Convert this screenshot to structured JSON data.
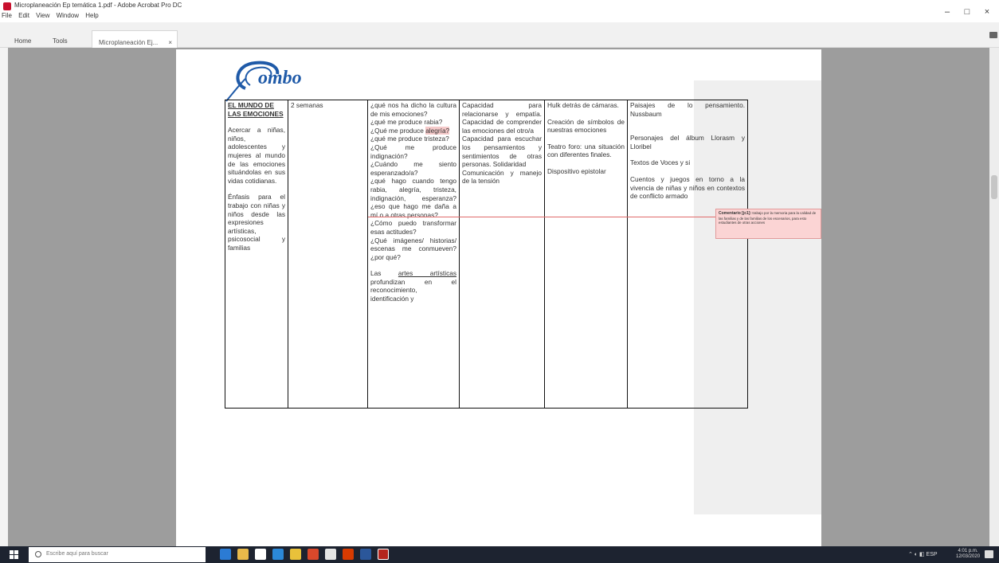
{
  "window": {
    "title": "Microplaneación Ep temática 1.pdf - Adobe Acrobat Pro DC",
    "menu": [
      "File",
      "Edit",
      "View",
      "Window",
      "Help"
    ],
    "controls": [
      "–",
      "□",
      "×"
    ]
  },
  "tabs": {
    "home": "Home",
    "tools": "Tools",
    "document": "Microplaneación Ej...",
    "close": "×"
  },
  "table": {
    "col1": {
      "title": "EL MUNDO DE LAS EMOCIONES",
      "p1": "Acercar a niñas, niños, adolescentes y mujeres al mundo de las emociones situándolas en sus vidas cotidianas.",
      "p2": "Énfasis para el trabajo con niñas y niños desde las expresiones artísticas, psicosocial y familias"
    },
    "col2": {
      "text": "2 semanas"
    },
    "col3": {
      "p1": "¿qué nos ha dicho la cultura de mis emociones?",
      "p2": "¿qué me produce rabia?",
      "p3a": "¿Qué me produce",
      "p3b": "alegría?",
      "p4": "¿qué me produce tristeza?",
      "p5": "¿Qué me produce indignación?",
      "p6": "¿Cuándo me siento esperanzado/a?",
      "p7": "¿qué hago cuando tengo rabia, alegría, tristeza, indignación, esperanza? ¿eso que hago me daña a mí o a otras personas?",
      "p8": "¿Cómo puedo transformar esas actitudes?",
      "p9": "¿Qué imágenes/ historias/ escenas me conmueven? ¿por qué?",
      "p10a": "Las",
      "p10b": "artes artísticas",
      "p10c": "profundizan en el reconocimiento, identificación y"
    },
    "col4": {
      "p1": "Capacidad para relacionarse y empatía. Capacidad de comprender las emociones del otro/a",
      "p2": "Capacidad para escuchar los pensamientos y sentimientos de otras personas. Solidaridad",
      "p3": "Comunicación y manejo de la tensión"
    },
    "col5": {
      "p1": "Hulk detrás de cámaras.",
      "p2": "Creación de símbolos de nuestras emociones",
      "p3": "Teatro foro: una situación con diferentes finales.",
      "p4": "Dispositivo epistolar"
    },
    "col6": {
      "p1": "Paisajes de lo pensamiento. Nussbaum",
      "p2": "Personajes del álbum Llorasm y Lloribel",
      "p3": "Textos de Voces y si",
      "p4": "Cuentos y juegos en torno a la vivencia de niñas y niños en contextos de conflicto armado"
    }
  },
  "comment": {
    "author": "Comentario [jc1]:",
    "text": "trabajo por la memoria para la calidad de las familias y de las familias de los escenarios, para esto estudiantes de otras acciones"
  },
  "taskbar": {
    "search_placeholder": "Escribe aquí para buscar",
    "tray_text": "ESP",
    "time": "4:01 p.m.",
    "date": "12/03/2020"
  },
  "colors": {
    "viewer_bg": "#9d9d9d",
    "comment_bg": "#fbd4d4",
    "highlight": "#f5caca",
    "taskbar": "#1d2330",
    "logo_blue": "#1f5aa8"
  }
}
